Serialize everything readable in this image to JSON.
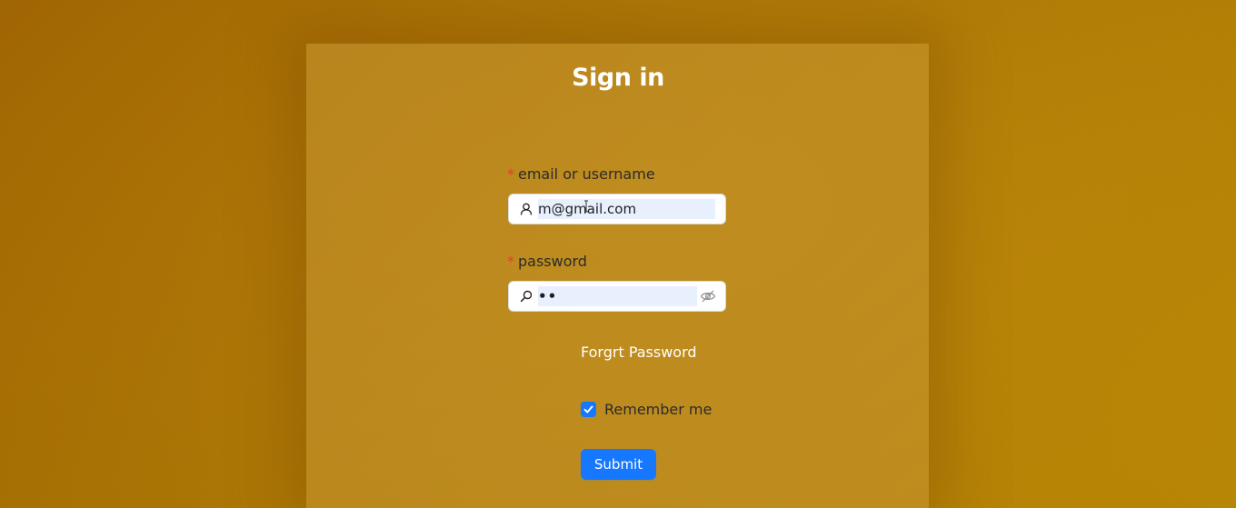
{
  "form": {
    "title": "Sign in",
    "email_label": "email or username",
    "email_value": "m@gmail.com",
    "password_label": "password",
    "password_value": "••",
    "required_mark": "*",
    "forgot_label": "Forgrt Password",
    "remember_label": "Remember me",
    "remember_checked": true,
    "submit_label": "Submit"
  },
  "icons": {
    "email_prefix": "user-icon",
    "password_prefix": "search-icon",
    "password_suffix": "eye-invisible-icon",
    "checkbox": "check-icon"
  },
  "colors": {
    "background": "#b57d05",
    "primary": "#1677ff",
    "required": "#e0402a",
    "autofill": "#e8f0fe"
  }
}
